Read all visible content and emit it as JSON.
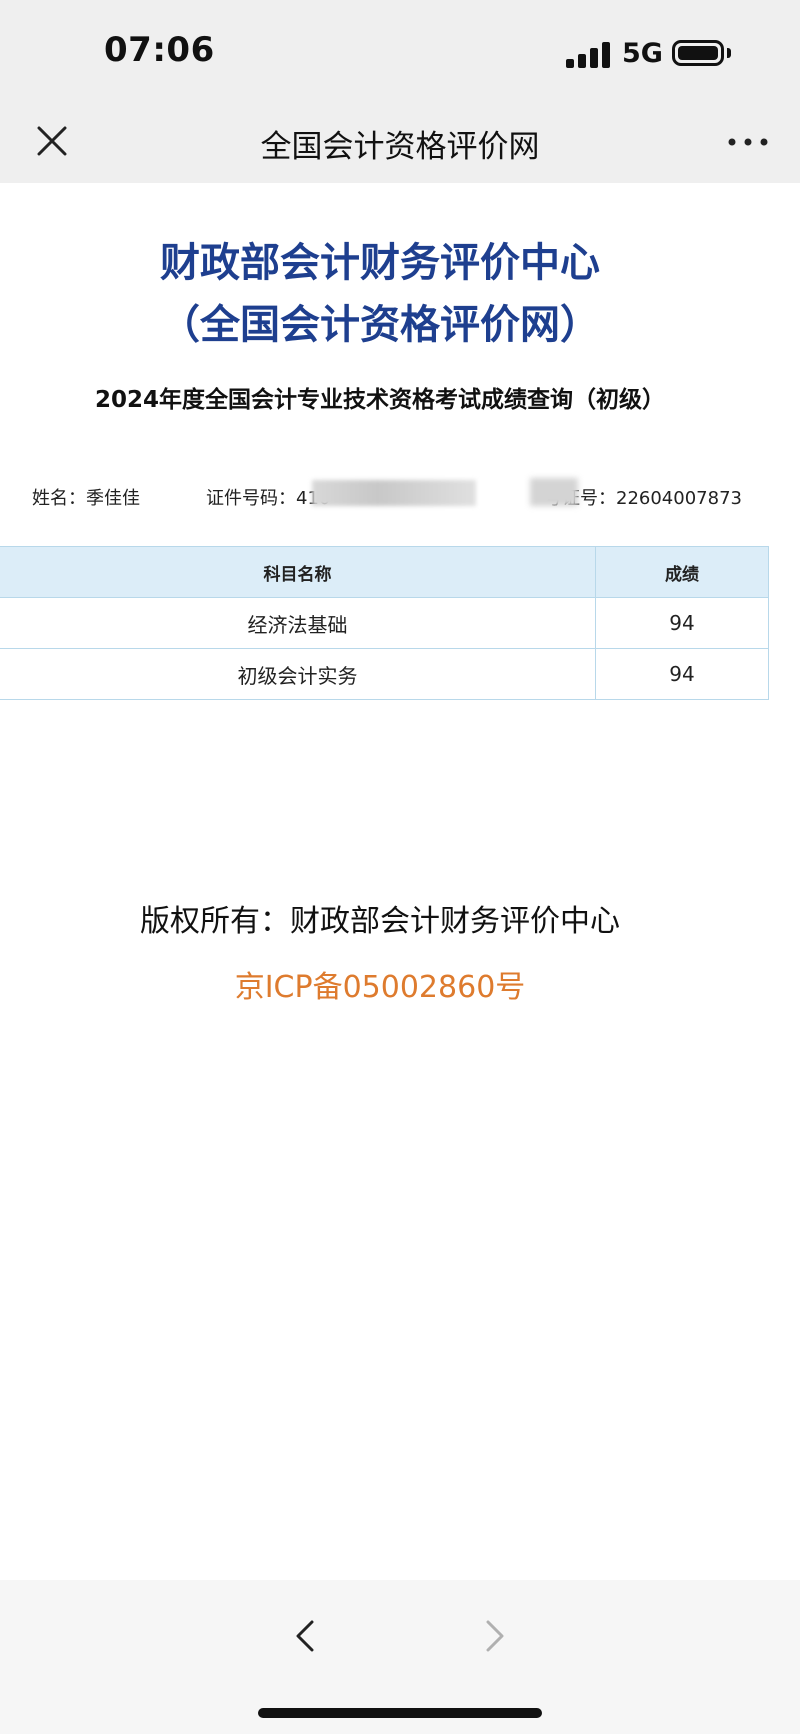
{
  "status_bar": {
    "time": "07:06",
    "network": "5G",
    "icons": [
      "signal-icon",
      "battery-icon"
    ]
  },
  "nav": {
    "title": "全国会计资格评价网",
    "icons": [
      "close-icon",
      "more-icon"
    ]
  },
  "site": {
    "title_line1": "财政部会计财务评价中心",
    "title_line2": "（全国会计资格评价网）"
  },
  "exam": {
    "heading": "2024年度全国会计专业技术资格考试成绩查询（初级）"
  },
  "candidate": {
    "name_label": "姓名：",
    "name": "季佳佳",
    "id_label": "证件号码：",
    "id_partial": "410",
    "ticket_suffix": "号证号：",
    "ticket_number": "22604007873"
  },
  "scores": {
    "headers": [
      "科目名称",
      "成绩"
    ],
    "rows": [
      {
        "subject": "经济法基础",
        "score": "94"
      },
      {
        "subject": "初级会计实务",
        "score": "94"
      }
    ]
  },
  "footer": {
    "copyright": "版权所有：财政部会计财务评价中心",
    "icp": "京ICP备05002860号",
    "icp_color": "#de7b2e"
  },
  "colors": {
    "title_blue": "#1e3f8f",
    "table_header_bg": "#dcedf8",
    "table_border": "#b8d8ea"
  },
  "bottom_bar": {
    "icons": [
      "back-icon",
      "forward-icon"
    ]
  }
}
